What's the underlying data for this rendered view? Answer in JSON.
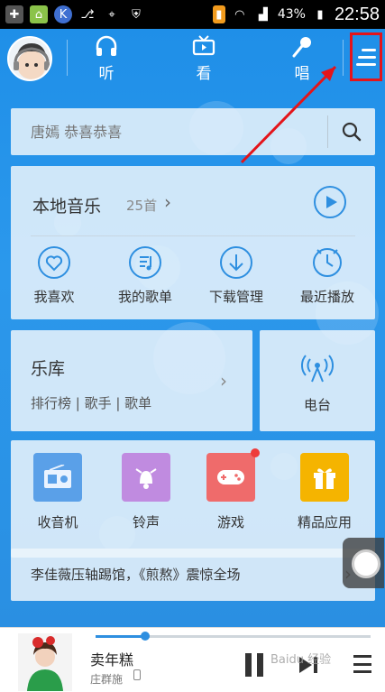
{
  "status_bar": {
    "battery_pct": "43%",
    "time": "22:58"
  },
  "nav": {
    "tabs": [
      {
        "label": "听",
        "icon": "headphones-icon"
      },
      {
        "label": "看",
        "icon": "tv-icon"
      },
      {
        "label": "唱",
        "icon": "microphone-icon"
      }
    ],
    "menu_icon": "menu-icon"
  },
  "search": {
    "placeholder": "唐嫣 恭喜恭喜",
    "icon": "search-icon"
  },
  "local_music": {
    "title": "本地音乐",
    "count": "25首",
    "items": [
      {
        "label": "我喜欢",
        "icon": "heart-cloud-icon"
      },
      {
        "label": "我的歌单",
        "icon": "playlist-icon"
      },
      {
        "label": "下载管理",
        "icon": "download-icon"
      },
      {
        "label": "最近播放",
        "icon": "clock-icon"
      }
    ]
  },
  "library": {
    "title": "乐库",
    "subtitle": "排行榜 | 歌手 | 歌单"
  },
  "radio": {
    "label": "电台",
    "icon": "radio-signal-icon"
  },
  "apps": [
    {
      "label": "收音机",
      "icon": "radio-icon",
      "color": "#5aa0e8"
    },
    {
      "label": "铃声",
      "icon": "bell-icon",
      "color": "#c08be0"
    },
    {
      "label": "游戏",
      "icon": "gamepad-icon",
      "color": "#ef6b6b"
    },
    {
      "label": "精品应用",
      "icon": "gift-icon",
      "color": "#f5b400"
    }
  ],
  "news": {
    "text": "李佳薇压轴踢馆，《煎熬》震惊全场"
  },
  "player": {
    "song": "卖年糕",
    "artist": "庄群施",
    "progress": 0.18
  },
  "colors": {
    "accent": "#2e8fe0",
    "highlight_box": "#e4141a"
  },
  "watermark": "Baidu 经验"
}
